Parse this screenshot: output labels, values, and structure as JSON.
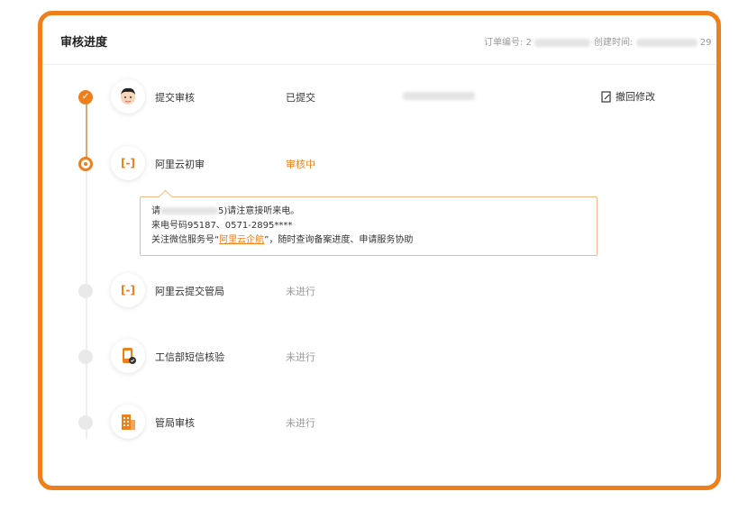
{
  "header": {
    "title": "审核进度",
    "order_label": "订单编号: 2",
    "created_label": "创建时间:",
    "created_tail": "29"
  },
  "steps": [
    {
      "name": "提交审核",
      "status": "已提交",
      "state": "done",
      "icon": "user-avatar-icon",
      "action": "撤回修改"
    },
    {
      "name": "阿里云初审",
      "status": "审核中",
      "state": "current",
      "icon": "aliyun-logo-icon"
    },
    {
      "name": "阿里云提交管局",
      "status": "未进行",
      "state": "pending",
      "icon": "aliyun-logo-icon"
    },
    {
      "name": "工信部短信核验",
      "status": "未进行",
      "state": "pending",
      "icon": "sms-verify-icon"
    },
    {
      "name": "管局审核",
      "status": "未进行",
      "state": "pending",
      "icon": "building-icon"
    }
  ],
  "notice": {
    "line1_tail": "5)请注意接听来电。",
    "line1_prefix": "请",
    "line2": "来电号码95187、0571-2895****",
    "line3_prefix": "关注微信服务号“",
    "line3_link": "阿里云企航",
    "line3_suffix": "”，随时查询备案进度、申请服务协助"
  },
  "colors": {
    "accent": "#ef7f1a",
    "pending": "#e9e9e9"
  }
}
